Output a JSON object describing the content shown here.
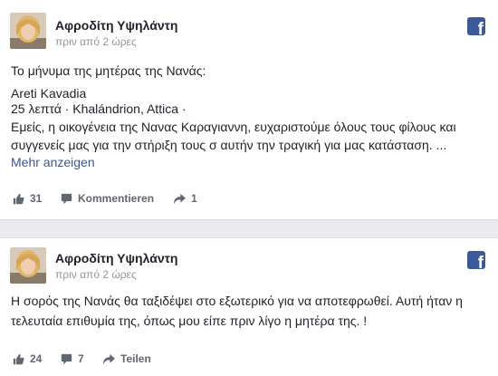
{
  "colors": {
    "brand": "#3b5998",
    "link": "#365899",
    "muted": "#90949c",
    "text": "#1d2129",
    "background": "#e9ebee"
  },
  "posts": [
    {
      "author": "Αφροδίτη Υψηλάντη",
      "time": "πριν από 2 ώρες",
      "avatar": "avatar-photo",
      "brand_icon": "facebook-icon",
      "lines": [
        "Το μήνυμα της μητέρας της Νανάς:",
        "Areti Kavadia",
        "25 λεπτά · Khalándrion, Attica ·",
        "Εμείς, η οικογένεια της Νανας Καραγιαννη, ευχαριστούμε όλους τους φίλους και",
        "συγγενείς μας για την στήριξη τους σ αυτήν την τραγική για μας κατάσταση. ..."
      ],
      "more_link": "Mehr anzeigen",
      "actions": [
        {
          "icon": "like-icon",
          "label": "31"
        },
        {
          "icon": "comment-icon",
          "label": "Kommentieren"
        },
        {
          "icon": "share-icon",
          "label": "1"
        }
      ]
    },
    {
      "author": "Αφροδίτη Υψηλάντη",
      "time": "πριν από 2 ώρες",
      "avatar": "avatar-photo",
      "brand_icon": "facebook-icon",
      "lines": [
        "Η σορός της Νανάς θα ταξιδέψει στο εξωτερικό για να αποτεφρωθεί. Αυτή ήταν η",
        "τελευταία επιθυμία της, όπως μου είπε πριν λίγο η μητέρα της. !"
      ],
      "actions": [
        {
          "icon": "like-icon",
          "label": "24"
        },
        {
          "icon": "comment-icon",
          "label": "7"
        },
        {
          "icon": "share-icon",
          "label": "Teilen"
        }
      ]
    }
  ]
}
